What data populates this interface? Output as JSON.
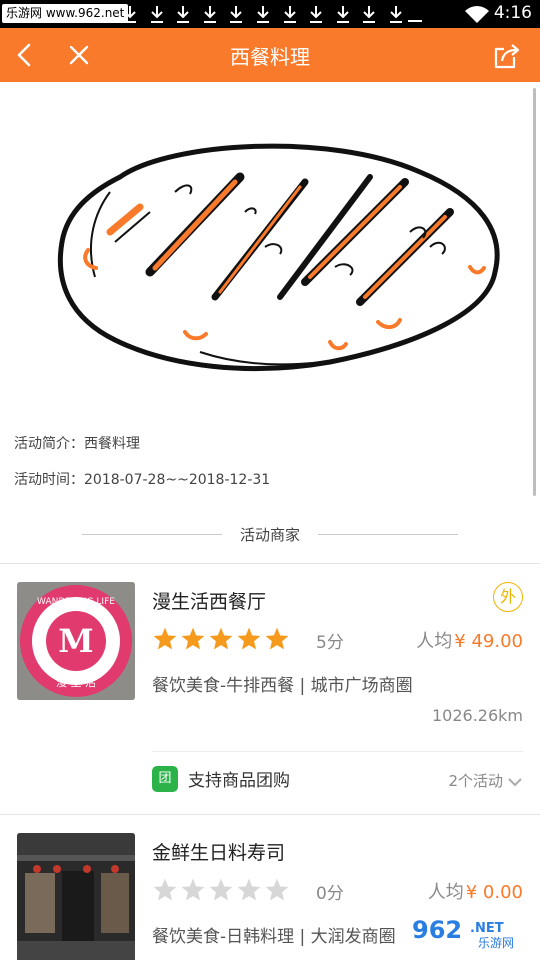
{
  "status_bar": {
    "site_label": "乐游网 www.962.net",
    "time": "4:16",
    "download_icon_count": 11
  },
  "header": {
    "title": "西餐料理",
    "bg_color": "#f97a2b"
  },
  "activity": {
    "intro_label": "活动简介：",
    "intro_value": "西餐料理",
    "time_label": "活动时间：",
    "time_value": "2018-07-28~~2018-12-31"
  },
  "section": {
    "title": "活动商家"
  },
  "merchants": [
    {
      "name": "漫生活西餐厅",
      "badge": "外",
      "rating": 5,
      "score_text": "5分",
      "avg_label": "人均",
      "avg_price": "¥ 49.00",
      "category": "餐饮美食-牛排西餐 | 城市广场商圈",
      "distance": "1026.26km",
      "group_icon": "团",
      "group_text": "支持商品团购",
      "activities": "2个活动",
      "logo_text_top": "WANDERING LIFE",
      "logo_letter": "M",
      "logo_text_bottom": "漫 生 活"
    },
    {
      "name": "金鲜生日料寿司",
      "rating": 0,
      "score_text": "0分",
      "avg_label": "人均",
      "avg_price": "¥ 0.00",
      "category": "餐饮美食-日韩料理 | 大润发商圈"
    }
  ],
  "watermark": {
    "text_big": "962",
    "text_net": ".NET",
    "text_sub": "乐游网"
  },
  "colors": {
    "accent": "#f97a2b",
    "star_on": "#f59a1c",
    "star_off": "#d7d7d7",
    "group_green": "#2bb34a",
    "badge_gold": "#f0b400"
  }
}
